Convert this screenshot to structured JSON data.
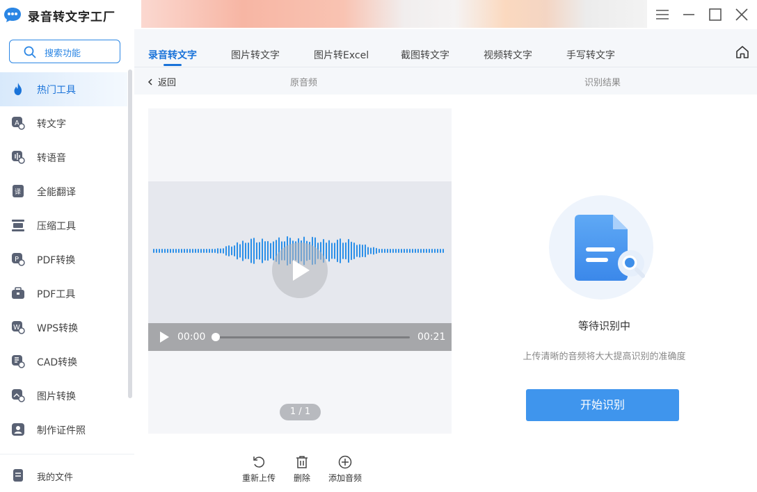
{
  "app": {
    "title": "录音转文字工厂",
    "accent": "#1a73d9",
    "logo_icon": "chat-bubble-logo-icon"
  },
  "window_controls": [
    "menu-icon",
    "minimize-icon",
    "maximize-icon",
    "close-icon"
  ],
  "sidebar": {
    "search_label": "搜索功能",
    "items": [
      {
        "label": "热门工具",
        "icon": "flame-icon",
        "active": true
      },
      {
        "label": "转文字",
        "icon": "text-convert-icon"
      },
      {
        "label": "转语音",
        "icon": "voice-convert-icon"
      },
      {
        "label": "全能翻译",
        "icon": "translate-icon"
      },
      {
        "label": "压缩工具",
        "icon": "compress-icon"
      },
      {
        "label": "PDF转换",
        "icon": "pdf-convert-icon"
      },
      {
        "label": "PDF工具",
        "icon": "pdf-tools-icon"
      },
      {
        "label": "WPS转换",
        "icon": "wps-convert-icon"
      },
      {
        "label": "CAD转换",
        "icon": "cad-convert-icon"
      },
      {
        "label": "图片转换",
        "icon": "image-convert-icon"
      },
      {
        "label": "制作证件照",
        "icon": "id-photo-icon"
      }
    ],
    "my_files": "我的文件"
  },
  "tabs": [
    {
      "label": "录音转文字",
      "active": true
    },
    {
      "label": "图片转文字"
    },
    {
      "label": "图片转Excel"
    },
    {
      "label": "截图转文字"
    },
    {
      "label": "视频转文字"
    },
    {
      "label": "手写转文字"
    }
  ],
  "subbar": {
    "back_label": "返回",
    "left_heading": "原音频",
    "right_heading": "识别结果"
  },
  "player": {
    "current_time": "00:00",
    "duration": "00:21",
    "progress": 0,
    "pager": "1 / 1",
    "wave_color": "#2b8fe8"
  },
  "actions": [
    {
      "label": "重新上传",
      "icon": "reupload-icon"
    },
    {
      "label": "删除",
      "icon": "trash-icon"
    },
    {
      "label": "添加音频",
      "icon": "add-circle-icon"
    }
  ],
  "result": {
    "status": "等待识别中",
    "hint": "上传清晰的音频将大大提高识别的准确度",
    "start_button": "开始识别",
    "button_color": "#3f95ed"
  }
}
